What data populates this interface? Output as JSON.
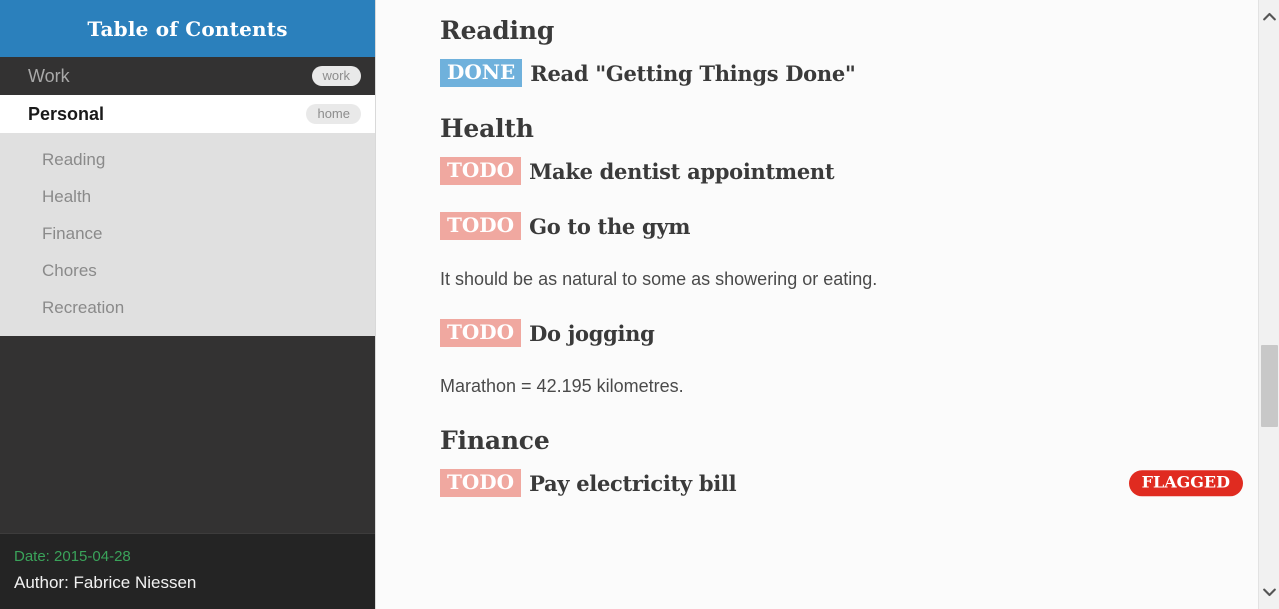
{
  "sidebar": {
    "header_title": "Table of Contents",
    "top_items": [
      {
        "label": "Work",
        "tag": "work",
        "active": false
      },
      {
        "label": "Personal",
        "tag": "home",
        "active": true
      }
    ],
    "sub_items": [
      {
        "label": "Reading"
      },
      {
        "label": "Health"
      },
      {
        "label": "Finance"
      },
      {
        "label": "Chores"
      },
      {
        "label": "Recreation"
      }
    ],
    "footer": {
      "date": "Date: 2015-04-28",
      "author": "Author: Fabrice Niessen"
    }
  },
  "main": {
    "blocks": [
      {
        "type": "heading",
        "text": "Reading"
      },
      {
        "type": "task",
        "keyword": "DONE",
        "keyword_class": "done",
        "title": "Read \"Getting Things Done\"",
        "flag": ""
      },
      {
        "type": "heading",
        "text": "Health"
      },
      {
        "type": "task",
        "keyword": "TODO",
        "keyword_class": "todo",
        "title": "Make dentist appointment",
        "flag": ""
      },
      {
        "type": "task",
        "keyword": "TODO",
        "keyword_class": "todo",
        "title": "Go to the gym",
        "flag": ""
      },
      {
        "type": "paragraph",
        "text": "It should be as natural to some as showering or eating."
      },
      {
        "type": "task",
        "keyword": "TODO",
        "keyword_class": "todo",
        "title": "Do jogging",
        "flag": ""
      },
      {
        "type": "paragraph",
        "text": "Marathon = 42.195 kilometres."
      },
      {
        "type": "heading",
        "text": "Finance"
      },
      {
        "type": "task",
        "keyword": "TODO",
        "keyword_class": "todo",
        "title": "Pay electricity bill",
        "flag": "FLAGGED"
      }
    ]
  },
  "scrollbar": {
    "up_icon": "chevron-up-icon",
    "down_icon": "chevron-down-icon"
  },
  "colors": {
    "header_blue": "#2b80bc",
    "sidebar_dark": "#333232",
    "sub_panel": "#e0e0e0",
    "todo": "#f0a8a0",
    "done": "#6fb1dc",
    "flagged": "#e02b20",
    "date_green": "#3aa35a"
  }
}
